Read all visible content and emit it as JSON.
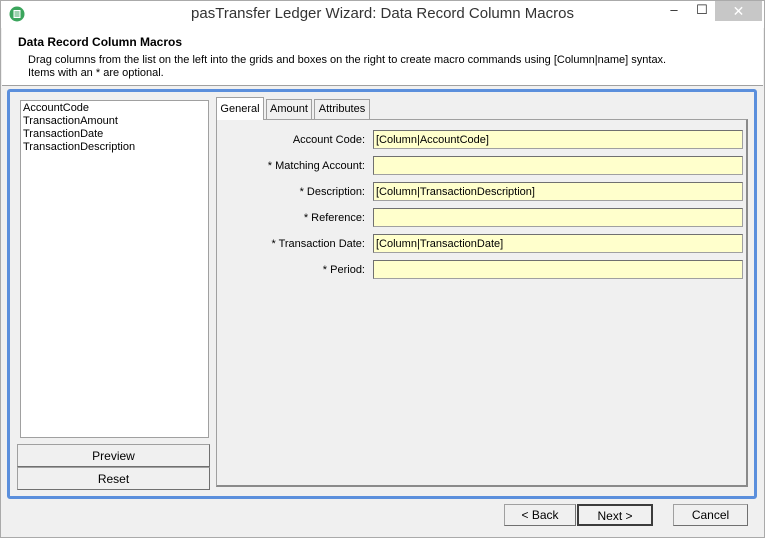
{
  "window": {
    "title": "pasTransfer Ledger Wizard: Data Record Column Macros",
    "minimize_glyph": "–",
    "maximize_glyph": "☐",
    "close_glyph": "✕"
  },
  "header": {
    "title": "Data Record Column Macros",
    "description_line1": "Drag columns from the list on the left into the grids and boxes on the right to create macro commands using [Column|name] syntax.",
    "description_line2": "Items with an * are optional."
  },
  "columns": [
    "AccountCode",
    "TransactionAmount",
    "TransactionDate",
    "TransactionDescription"
  ],
  "side_buttons": {
    "preview": "Preview",
    "reset": "Reset"
  },
  "tabs": [
    {
      "label": "General",
      "active": true
    },
    {
      "label": "Amount",
      "active": false
    },
    {
      "label": "Attributes",
      "active": false
    }
  ],
  "fields": [
    {
      "label": "Account Code:",
      "value": "[Column|AccountCode]"
    },
    {
      "label": "* Matching Account:",
      "value": ""
    },
    {
      "label": "* Description:",
      "value": "[Column|TransactionDescription]"
    },
    {
      "label": "* Reference:",
      "value": ""
    },
    {
      "label": "* Transaction Date:",
      "value": "[Column|TransactionDate]"
    },
    {
      "label": "* Period:",
      "value": ""
    }
  ],
  "footer": {
    "back": "< Back",
    "next": "Next >",
    "cancel": "Cancel"
  },
  "colors": {
    "accent_frame": "#5b8fdc",
    "input_background": "#ffffcc",
    "app_icon": "#3ba55c"
  },
  "icons": {
    "app": "app-logo-icon"
  }
}
